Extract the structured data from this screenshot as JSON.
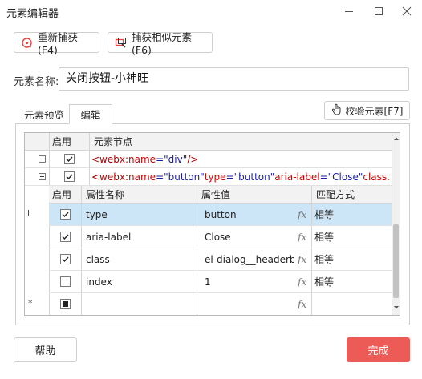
{
  "window": {
    "title": "元素编辑器"
  },
  "toolbar": {
    "recapture_label": "重新捕获(F4)",
    "capture_similar_label": "捕获相似元素(F6)"
  },
  "element_name": {
    "label": "元素名称:",
    "value": "关闭按钮-小神旺"
  },
  "tabs": [
    {
      "label": "元素预览",
      "active": false
    },
    {
      "label": "编辑",
      "active": true
    }
  ],
  "verify_button_label": "校验元素[F7]",
  "node_grid": {
    "headers": {
      "enable": "启用",
      "node": "元素节点"
    },
    "nodes": [
      {
        "checked": true,
        "parts": [
          "<web ",
          "x:name",
          "=",
          "\"div\"",
          " />"
        ]
      },
      {
        "checked": true,
        "parts": [
          "<web ",
          "x:name",
          "=",
          "\"button\"",
          " ",
          "type",
          "=",
          "\"button\"",
          " ",
          "aria-label",
          "=",
          "\"Close\"",
          " class..."
        ]
      }
    ]
  },
  "attr_grid": {
    "headers": {
      "enable": "启用",
      "name": "属性名称",
      "value": "属性值",
      "match": "匹配方式"
    },
    "rows": [
      {
        "checked": true,
        "name": "type",
        "value": "button",
        "fx": "fx",
        "match": "相等",
        "selected": true
      },
      {
        "checked": true,
        "name": "aria-label",
        "value": "Close",
        "fx": "fx",
        "match": "相等",
        "selected": false
      },
      {
        "checked": true,
        "name": "class",
        "value": "el-dialog__headerb",
        "fx": "fx",
        "match": "相等",
        "selected": false
      },
      {
        "checked": false,
        "name": "index",
        "value": "1",
        "fx": "fx",
        "match": "相等",
        "selected": false
      },
      {
        "checked": "indeterminate",
        "name": "",
        "value": "",
        "fx": "fx",
        "match": "",
        "selected": false
      }
    ]
  },
  "footer": {
    "help_label": "帮助",
    "done_label": "完成"
  },
  "colors": {
    "accent": "#ec5b56",
    "selected_row": "#cde6f7",
    "xml_tag": "#b00000",
    "xml_value": "#1a1aa6"
  }
}
